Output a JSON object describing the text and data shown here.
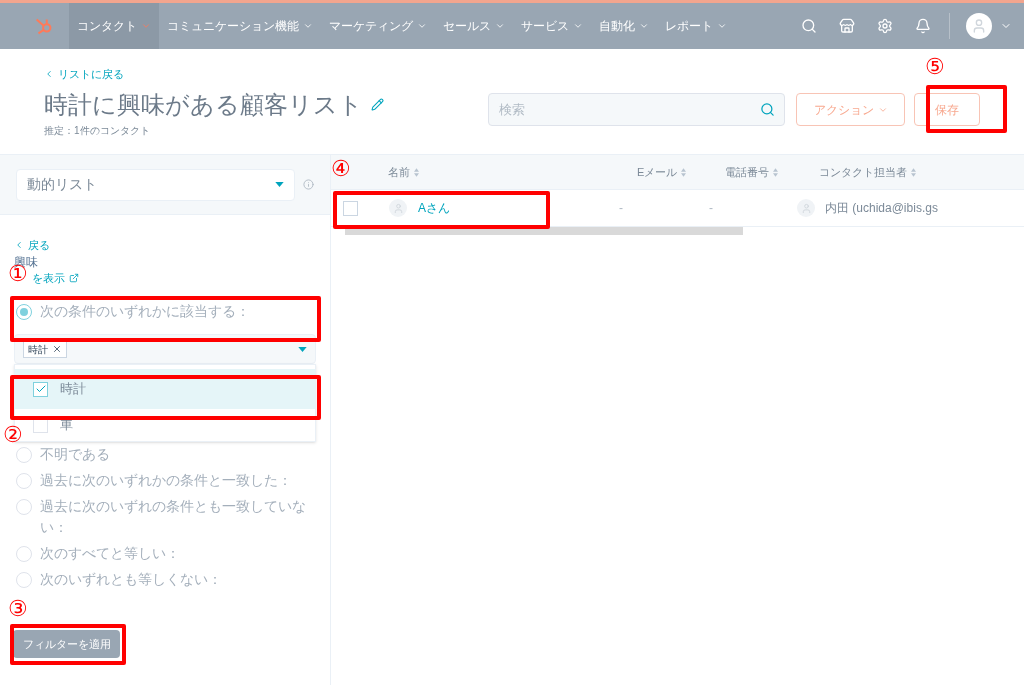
{
  "nav": {
    "items": [
      {
        "label": "コンタクト",
        "selected": true
      },
      {
        "label": "コミュニケーション機能",
        "selected": false
      },
      {
        "label": "マーケティング",
        "selected": false
      },
      {
        "label": "セールス",
        "selected": false
      },
      {
        "label": "サービス",
        "selected": false
      },
      {
        "label": "自動化",
        "selected": false
      },
      {
        "label": "レポート",
        "selected": false
      }
    ]
  },
  "header": {
    "back_link": "リストに戻る",
    "title": "時計に興味がある顧客リスト",
    "subtitle": "推定：1件のコンタクト",
    "search": {
      "placeholder": "検索"
    },
    "actions_button": "アクション",
    "save_button": "保存"
  },
  "sidebar": {
    "list_type": "動的リスト",
    "back_link": "戻る",
    "property": "興味",
    "details_link": "を表示",
    "radios": [
      {
        "label": "次の条件のいずれかに該当する：",
        "selected": true
      },
      {
        "label": "不明である",
        "selected": false
      },
      {
        "label": "過去に次のいずれかの条件と一致した：",
        "selected": false
      },
      {
        "label": "過去に次のいずれの条件とも一致していない：",
        "selected": false
      },
      {
        "label": "次のすべてと等しい：",
        "selected": false
      },
      {
        "label": "次のいずれとも等しくない：",
        "selected": false
      }
    ],
    "filter": {
      "tags": [
        "時計"
      ],
      "options": [
        {
          "label": "時計",
          "checked": true
        },
        {
          "label": "車",
          "checked": false
        }
      ]
    },
    "apply_button": "フィルターを適用"
  },
  "table": {
    "columns": [
      "名前",
      "Eメール",
      "電話番号",
      "コンタクト担当者"
    ],
    "rows": [
      {
        "name": "Aさん",
        "email": "-",
        "phone": "-",
        "owner": "内田 (uchida@ibis.gs",
        "selected": false
      }
    ]
  },
  "annotations": [
    "①",
    "②",
    "③",
    "④",
    "⑤"
  ]
}
